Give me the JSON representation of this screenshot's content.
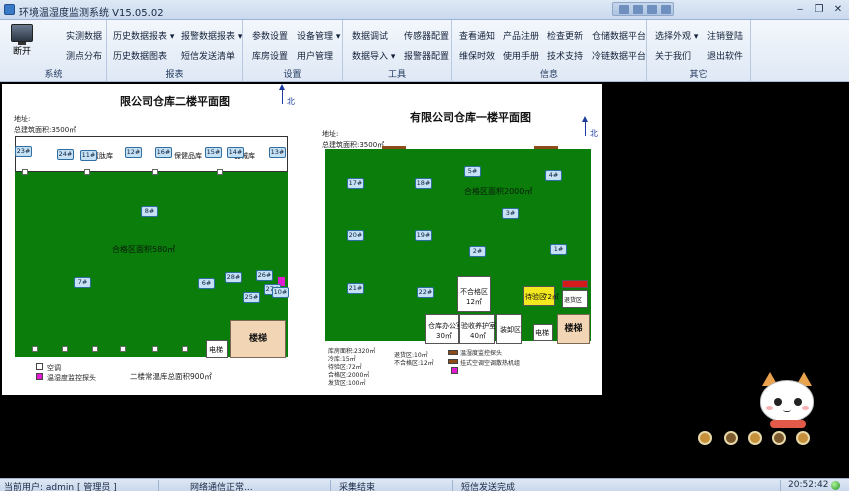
{
  "window": {
    "title": "环境温湿度监测系统 V15.05.02",
    "controls": {
      "minimize": "‒",
      "restore": "❐",
      "close": "✕"
    }
  },
  "ribbon": {
    "groups": [
      {
        "label": "系统",
        "buttons": [
          "断开"
        ]
      },
      {
        "label": "报表",
        "buttons": [
          "实测数据",
          "测点分布",
          "历史数据报表 ▾",
          "历史数据图表",
          "报警数据报表 ▾",
          "短信发送清单"
        ]
      },
      {
        "label": "设置",
        "buttons": [
          "参数设置",
          "库房设置",
          "设备管理 ▾",
          "用户管理"
        ]
      },
      {
        "label": "工具",
        "buttons": [
          "数据调试",
          "数据导入 ▾",
          "传感器配置",
          "报警器配置"
        ]
      },
      {
        "label": "信息",
        "buttons": [
          "查看通知",
          "维保时效",
          "产品注册",
          "使用手册",
          "检查更新",
          "技术支持",
          "仓储数据平台",
          "冷链数据平台"
        ]
      },
      {
        "label": "其它",
        "buttons": [
          "选择外观 ▾",
          "关于我们",
          "注销登陆",
          "退出软件"
        ]
      }
    ]
  },
  "floor2": {
    "title": "限公司仓库二楼平面图",
    "address": "地址:",
    "total_area": "总建筑面积:3500㎡",
    "north": "北",
    "rooms": [
      "蛋肽库",
      "保健品库",
      "器械库"
    ],
    "qualified_area": "合格区面积580㎡",
    "stairs": "楼梯",
    "elevator": "电梯",
    "legend_ac": "空调",
    "legend_sensor": "温湿度监控探头",
    "footer": "二楼常温库总面积900㎡",
    "sensors": [
      "23#",
      "24#",
      "11#",
      "12#",
      "16#",
      "15#",
      "14#",
      "13#",
      "8#",
      "7#",
      "6#",
      "28#",
      "26#",
      "25#",
      "27#",
      "10#"
    ]
  },
  "floor1": {
    "title": "有限公司仓库一楼平面图",
    "address": "地址:",
    "total_area": "总建筑面积:3500㎡",
    "north": "北",
    "qualified_area": "合格区面积2000㎡",
    "stairs": "楼梯",
    "elevator": "电梯",
    "rooms": {
      "unqualified": "不合格区",
      "office": "仓库办公室",
      "office_area": "30㎡",
      "maintenance": "验收养护室",
      "maintenance_area": "40㎡",
      "unloading": "装卸区",
      "pending": "待验区",
      "pending_area": "72㎡",
      "return": "退货区",
      "area_12": "12㎡"
    },
    "area_notes": [
      "库房面积:2320㎡",
      "冷库:15㎡",
      "待验区:72㎡",
      "合格区:2000㎡",
      "发货区:100㎡"
    ],
    "notes2": [
      "退货区:10㎡",
      "不合格区:12㎡"
    ],
    "legend_sensor": "温湿度监控探头",
    "legend_ac": "挂式空调空调散热机组",
    "sensors": [
      "17#",
      "18#",
      "5#",
      "4#",
      "3#",
      "20#",
      "19#",
      "2#",
      "1#",
      "21#",
      "22#"
    ]
  },
  "statusbar": {
    "user": "当前用户: admin [ 管理员 ]",
    "network": "网络通信正常...",
    "collect": "采集结束",
    "sms": "短信发送完成",
    "time": "20:52:42"
  },
  "colors": {
    "floor_green": "#0a7d0a",
    "stairs": "#f2d5b4",
    "sensor": "#c7e1f4",
    "pending_yellow": "#f3e81f",
    "return_red": "#d41b1b",
    "legend_magenta": "#e01bd1",
    "ribbon_blue": "#dfe8f5"
  }
}
